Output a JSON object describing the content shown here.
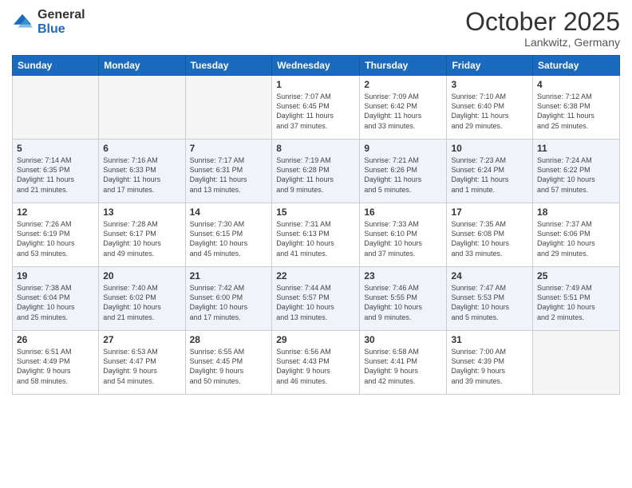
{
  "logo": {
    "general": "General",
    "blue": "Blue"
  },
  "title": "October 2025",
  "location": "Lankwitz, Germany",
  "days_header": [
    "Sunday",
    "Monday",
    "Tuesday",
    "Wednesday",
    "Thursday",
    "Friday",
    "Saturday"
  ],
  "weeks": [
    [
      {
        "day": "",
        "info": ""
      },
      {
        "day": "",
        "info": ""
      },
      {
        "day": "",
        "info": ""
      },
      {
        "day": "1",
        "info": "Sunrise: 7:07 AM\nSunset: 6:45 PM\nDaylight: 11 hours\nand 37 minutes."
      },
      {
        "day": "2",
        "info": "Sunrise: 7:09 AM\nSunset: 6:42 PM\nDaylight: 11 hours\nand 33 minutes."
      },
      {
        "day": "3",
        "info": "Sunrise: 7:10 AM\nSunset: 6:40 PM\nDaylight: 11 hours\nand 29 minutes."
      },
      {
        "day": "4",
        "info": "Sunrise: 7:12 AM\nSunset: 6:38 PM\nDaylight: 11 hours\nand 25 minutes."
      }
    ],
    [
      {
        "day": "5",
        "info": "Sunrise: 7:14 AM\nSunset: 6:35 PM\nDaylight: 11 hours\nand 21 minutes."
      },
      {
        "day": "6",
        "info": "Sunrise: 7:16 AM\nSunset: 6:33 PM\nDaylight: 11 hours\nand 17 minutes."
      },
      {
        "day": "7",
        "info": "Sunrise: 7:17 AM\nSunset: 6:31 PM\nDaylight: 11 hours\nand 13 minutes."
      },
      {
        "day": "8",
        "info": "Sunrise: 7:19 AM\nSunset: 6:28 PM\nDaylight: 11 hours\nand 9 minutes."
      },
      {
        "day": "9",
        "info": "Sunrise: 7:21 AM\nSunset: 6:26 PM\nDaylight: 11 hours\nand 5 minutes."
      },
      {
        "day": "10",
        "info": "Sunrise: 7:23 AM\nSunset: 6:24 PM\nDaylight: 11 hours\nand 1 minute."
      },
      {
        "day": "11",
        "info": "Sunrise: 7:24 AM\nSunset: 6:22 PM\nDaylight: 10 hours\nand 57 minutes."
      }
    ],
    [
      {
        "day": "12",
        "info": "Sunrise: 7:26 AM\nSunset: 6:19 PM\nDaylight: 10 hours\nand 53 minutes."
      },
      {
        "day": "13",
        "info": "Sunrise: 7:28 AM\nSunset: 6:17 PM\nDaylight: 10 hours\nand 49 minutes."
      },
      {
        "day": "14",
        "info": "Sunrise: 7:30 AM\nSunset: 6:15 PM\nDaylight: 10 hours\nand 45 minutes."
      },
      {
        "day": "15",
        "info": "Sunrise: 7:31 AM\nSunset: 6:13 PM\nDaylight: 10 hours\nand 41 minutes."
      },
      {
        "day": "16",
        "info": "Sunrise: 7:33 AM\nSunset: 6:10 PM\nDaylight: 10 hours\nand 37 minutes."
      },
      {
        "day": "17",
        "info": "Sunrise: 7:35 AM\nSunset: 6:08 PM\nDaylight: 10 hours\nand 33 minutes."
      },
      {
        "day": "18",
        "info": "Sunrise: 7:37 AM\nSunset: 6:06 PM\nDaylight: 10 hours\nand 29 minutes."
      }
    ],
    [
      {
        "day": "19",
        "info": "Sunrise: 7:38 AM\nSunset: 6:04 PM\nDaylight: 10 hours\nand 25 minutes."
      },
      {
        "day": "20",
        "info": "Sunrise: 7:40 AM\nSunset: 6:02 PM\nDaylight: 10 hours\nand 21 minutes."
      },
      {
        "day": "21",
        "info": "Sunrise: 7:42 AM\nSunset: 6:00 PM\nDaylight: 10 hours\nand 17 minutes."
      },
      {
        "day": "22",
        "info": "Sunrise: 7:44 AM\nSunset: 5:57 PM\nDaylight: 10 hours\nand 13 minutes."
      },
      {
        "day": "23",
        "info": "Sunrise: 7:46 AM\nSunset: 5:55 PM\nDaylight: 10 hours\nand 9 minutes."
      },
      {
        "day": "24",
        "info": "Sunrise: 7:47 AM\nSunset: 5:53 PM\nDaylight: 10 hours\nand 5 minutes."
      },
      {
        "day": "25",
        "info": "Sunrise: 7:49 AM\nSunset: 5:51 PM\nDaylight: 10 hours\nand 2 minutes."
      }
    ],
    [
      {
        "day": "26",
        "info": "Sunrise: 6:51 AM\nSunset: 4:49 PM\nDaylight: 9 hours\nand 58 minutes."
      },
      {
        "day": "27",
        "info": "Sunrise: 6:53 AM\nSunset: 4:47 PM\nDaylight: 9 hours\nand 54 minutes."
      },
      {
        "day": "28",
        "info": "Sunrise: 6:55 AM\nSunset: 4:45 PM\nDaylight: 9 hours\nand 50 minutes."
      },
      {
        "day": "29",
        "info": "Sunrise: 6:56 AM\nSunset: 4:43 PM\nDaylight: 9 hours\nand 46 minutes."
      },
      {
        "day": "30",
        "info": "Sunrise: 6:58 AM\nSunset: 4:41 PM\nDaylight: 9 hours\nand 42 minutes."
      },
      {
        "day": "31",
        "info": "Sunrise: 7:00 AM\nSunset: 4:39 PM\nDaylight: 9 hours\nand 39 minutes."
      },
      {
        "day": "",
        "info": ""
      }
    ]
  ]
}
